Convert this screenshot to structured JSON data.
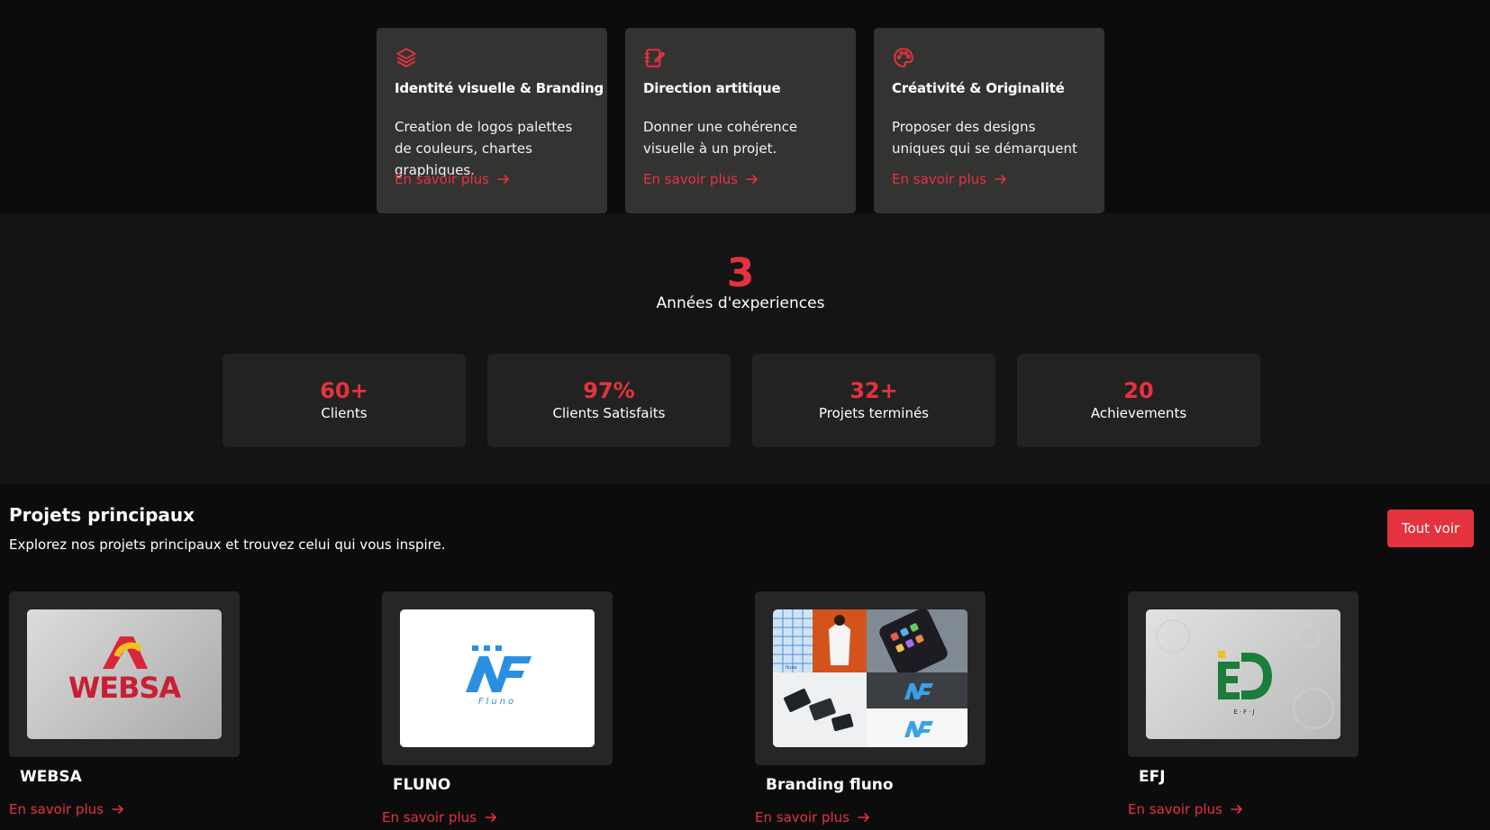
{
  "services": [
    {
      "icon": "layers-icon",
      "title": "Identité visuelle & Branding",
      "description": "Creation de logos palettes de couleurs, chartes graphiques.",
      "link": "En savoir plus"
    },
    {
      "icon": "edit-note-icon",
      "title": "Direction artitique",
      "description": "Donner une cohérence visuelle à un projet.",
      "link": "En savoir plus"
    },
    {
      "icon": "palette-icon",
      "title": "Créativité & Originalité",
      "description": "Proposer des designs uniques qui se démarquent",
      "link": "En savoir plus"
    }
  ],
  "experience": {
    "value": "3",
    "label": "Années d'experiences"
  },
  "stats": [
    {
      "value": "60+",
      "label": "Clients"
    },
    {
      "value": "97%",
      "label": "Clients Satisfaits"
    },
    {
      "value": "32+",
      "label": "Projets terminés"
    },
    {
      "value": "20",
      "label": "Achievements"
    }
  ],
  "projects_section": {
    "title": "Projets principaux",
    "subtitle": "Explorez nos projets principaux et trouvez celui qui vous inspire.",
    "button": "Tout voir"
  },
  "projects": [
    {
      "name": "WEBSA",
      "link": "En savoir plus",
      "logo_text": "WEBSA"
    },
    {
      "name": "FLUNO",
      "link": "En savoir plus",
      "logo_text": "Fluno"
    },
    {
      "name": "Branding fluno",
      "link": "En savoir plus",
      "logo_text": "fluno"
    },
    {
      "name": "EFJ",
      "link": "En savoir plus",
      "logo_text": "E·F·J"
    }
  ],
  "colors": {
    "accent": "#e5323f",
    "card": "#333432",
    "stat_card": "#222222"
  }
}
